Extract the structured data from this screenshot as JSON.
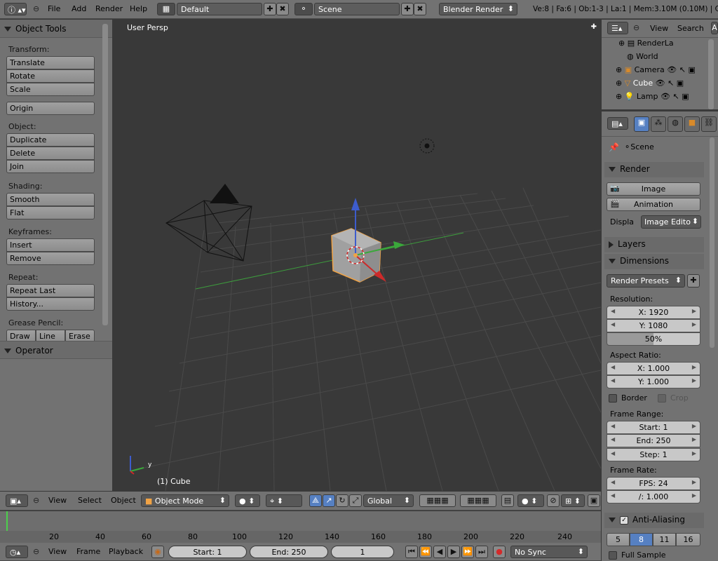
{
  "topbar": {
    "menus": [
      "File",
      "Add",
      "Render",
      "Help"
    ],
    "screen_layout": "Default",
    "scene": "Scene",
    "render_engine": "Blender Render",
    "stats": "Ve:8 | Fa:6 | Ob:1-3 | La:1 | Mem:3.10M (0.10M) | Cu"
  },
  "toolshelf": {
    "title": "Object Tools",
    "transform_label": "Transform:",
    "translate": "Translate",
    "rotate": "Rotate",
    "scale": "Scale",
    "origin": "Origin",
    "object_label": "Object:",
    "duplicate": "Duplicate",
    "delete": "Delete",
    "join": "Join",
    "shading_label": "Shading:",
    "smooth": "Smooth",
    "flat": "Flat",
    "keyframes_label": "Keyframes:",
    "insert": "Insert",
    "remove": "Remove",
    "repeat_label": "Repeat:",
    "repeat_last": "Repeat Last",
    "history": "History...",
    "grease_label": "Grease Pencil:",
    "draw": "Draw",
    "line": "Line",
    "erase": "Erase",
    "operator": "Operator"
  },
  "viewport": {
    "view_name": "User Persp",
    "object_label": "(1) Cube"
  },
  "view3d_header": {
    "menus": [
      "View",
      "Select",
      "Object"
    ],
    "mode": "Object Mode",
    "orientation": "Global"
  },
  "timeline": {
    "ticks": [
      "20",
      "40",
      "60",
      "80",
      "100",
      "120",
      "140",
      "160",
      "180",
      "200",
      "220",
      "240"
    ],
    "menus": [
      "View",
      "Frame",
      "Playback"
    ],
    "start": "Start: 1",
    "end": "End: 250",
    "current": "1",
    "sync": "No Sync"
  },
  "outliner": {
    "menus": [
      "View",
      "Search"
    ],
    "items": [
      "RenderLa",
      "World",
      "Camera",
      "Cube",
      "Lamp"
    ]
  },
  "properties": {
    "scene": "Scene",
    "render_section": "Render",
    "image_btn": "Image",
    "animation_btn": "Animation",
    "display_label": "Displa",
    "display_value": "Image Edito",
    "layers_section": "Layers",
    "dimensions_section": "Dimensions",
    "presets": "Render Presets",
    "resolution_label": "Resolution:",
    "res_x": "X: 1920",
    "res_y": "Y: 1080",
    "res_pct": "50%",
    "aspect_label": "Aspect Ratio:",
    "asp_x": "X: 1.000",
    "asp_y": "Y: 1.000",
    "border": "Border",
    "crop": "Crop",
    "frame_range_label": "Frame Range:",
    "start": "Start: 1",
    "end": "End: 250",
    "step": "Step: 1",
    "frame_rate_label": "Frame Rate:",
    "fps": "FPS: 24",
    "fps_base": "/: 1.000",
    "aa_section": "Anti-Aliasing",
    "aa_samples": [
      "5",
      "8",
      "11",
      "16"
    ],
    "aa_selected": "8",
    "full_sample": "Full Sample"
  },
  "colors": {
    "header": "#727272",
    "viewport_bg": "#393939",
    "selected_blue": "#5680c2",
    "selection_orange": "#f1a345"
  }
}
